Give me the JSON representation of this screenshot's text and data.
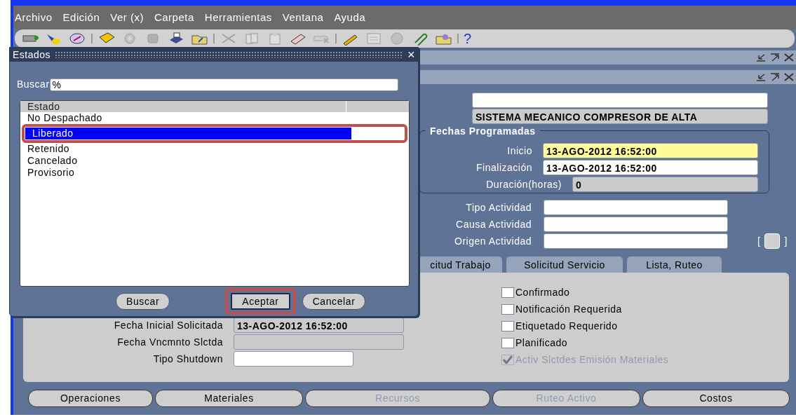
{
  "menu": [
    "Archivo",
    "Edición",
    "Ver (x)",
    "Carpeta",
    "Herramientas",
    "Ventana",
    "Ayuda"
  ],
  "toolbar": [
    {
      "kind": "button",
      "disabled": false
    },
    {
      "kind": "button",
      "disabled": false
    },
    {
      "kind": "button",
      "disabled": false
    },
    {
      "kind": "separator"
    },
    {
      "kind": "button",
      "disabled": false
    },
    {
      "kind": "button",
      "disabled": true
    },
    {
      "kind": "button",
      "disabled": true
    },
    {
      "kind": "button",
      "disabled": false
    },
    {
      "kind": "button",
      "disabled": false
    },
    {
      "kind": "separator"
    },
    {
      "kind": "button",
      "disabled": true
    },
    {
      "kind": "button",
      "disabled": true
    },
    {
      "kind": "button",
      "disabled": true
    },
    {
      "kind": "button",
      "disabled": false
    },
    {
      "kind": "button",
      "disabled": true
    },
    {
      "kind": "separator"
    },
    {
      "kind": "button",
      "disabled": false
    },
    {
      "kind": "button",
      "disabled": true
    },
    {
      "kind": "button",
      "disabled": true
    },
    {
      "kind": "button",
      "disabled": false
    },
    {
      "kind": "button",
      "disabled": false
    },
    {
      "kind": "separator"
    },
    {
      "kind": "text",
      "label": "?"
    }
  ],
  "description": "SISTEMA MECANICO COMPRESOR DE ALTA",
  "scheduled_dates": {
    "title": "Fechas Programadas",
    "fields": [
      {
        "label": "Inicio",
        "value": "13-AGO-2012 16:52:00",
        "required": true,
        "readonly": false
      },
      {
        "label": "Finalización",
        "value": "13-AGO-2012 16:52:00",
        "required": false,
        "readonly": false
      },
      {
        "label": "Duración(horas)",
        "value": "0",
        "required": false,
        "readonly": true
      }
    ]
  },
  "activity_fields": [
    {
      "label": "Tipo Actividad"
    },
    {
      "label": "Causa Actividad"
    },
    {
      "label": "Origen Actividad"
    }
  ],
  "bracket_button": {
    "left": "[",
    "right": "]"
  },
  "tabs": [
    {
      "label": "citud Trabajo",
      "selected": false
    },
    {
      "label": "Solicitud Servicio",
      "selected": false
    },
    {
      "label": "Lista, Ruteo",
      "selected": false
    }
  ],
  "tab_panel": {
    "fields": [
      {
        "label": "Fecha Inicial Solicitada",
        "value": "13-AGO-2012 16:52:00",
        "readonly": true
      },
      {
        "label": "Fecha Vncmnto Slctda",
        "readonly": true
      },
      {
        "label": "Tipo Shutdown",
        "readonly": false
      }
    ],
    "checkboxes": [
      {
        "label": "Confirmado",
        "checked": false,
        "disabled": false
      },
      {
        "label": "Notificación Requerida",
        "checked": false,
        "disabled": false
      },
      {
        "label": "Etiquetado Requerido",
        "checked": false,
        "disabled": false
      },
      {
        "label": "Planificado",
        "checked": false,
        "disabled": false
      },
      {
        "label": "Activ Slctdes Emisión Materiales",
        "checked": true,
        "disabled": true
      }
    ]
  },
  "buttons": [
    {
      "label": "Operaciones",
      "disabled": false
    },
    {
      "label": "Materiales",
      "disabled": false
    },
    {
      "label": "Recursos",
      "disabled": true
    },
    {
      "label": "Ruteo Activo",
      "disabled": true
    },
    {
      "label": "Costos",
      "disabled": false
    }
  ],
  "dialog": {
    "title": "Estados",
    "close": "×",
    "search_label": "Buscar",
    "search_value": "%",
    "column": "Estado",
    "items": [
      {
        "label": "No Despachado",
        "selected": false,
        "highlighted": false
      },
      {
        "label": "Liberado",
        "selected": true,
        "highlighted": true
      },
      {
        "label": "Retenido",
        "selected": false,
        "highlighted": false
      },
      {
        "label": "Cancelado",
        "selected": false,
        "highlighted": false
      },
      {
        "label": "Provisorio",
        "selected": false,
        "highlighted": false
      }
    ],
    "buttons": [
      {
        "label": "Buscar",
        "default": false,
        "highlighted": false
      },
      {
        "label": "Aceptar",
        "default": true,
        "highlighted": true
      },
      {
        "label": "Cancelar",
        "default": false,
        "highlighted": false
      }
    ]
  }
}
